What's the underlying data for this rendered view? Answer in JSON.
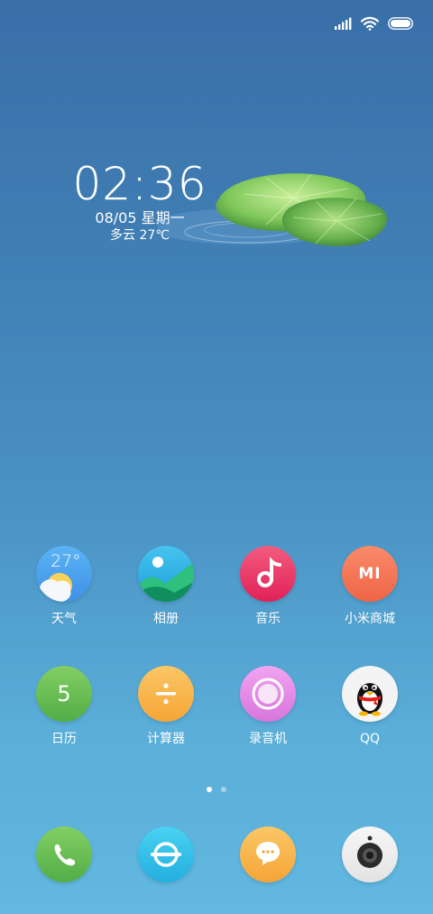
{
  "status_bar": {
    "icons": [
      "signal-icon",
      "wifi-icon",
      "battery-icon"
    ]
  },
  "clock": {
    "time": "02:36",
    "date": "08/05 星期一",
    "weather": "多云 27℃"
  },
  "apps": [
    {
      "label": "天气",
      "icon": "weather-icon",
      "badge_text": "27°",
      "color": "#4aa3f0"
    },
    {
      "label": "相册",
      "icon": "gallery-icon",
      "color": "#2db4e6"
    },
    {
      "label": "音乐",
      "icon": "music-icon",
      "color": "#ef3d6a"
    },
    {
      "label": "小米商城",
      "icon": "mi-store-icon",
      "badge_text": "MI",
      "color": "#f4785a"
    },
    {
      "label": "日历",
      "icon": "calendar-icon",
      "badge_text": "5",
      "color": "#6cc25a"
    },
    {
      "label": "计算器",
      "icon": "calculator-icon",
      "color": "#f8b64c"
    },
    {
      "label": "录音机",
      "icon": "recorder-icon",
      "color": "#e88de8"
    },
    {
      "label": "QQ",
      "icon": "qq-icon",
      "color": "#f2f2f2"
    }
  ],
  "page_indicator": {
    "pages": 2,
    "active": 1
  },
  "dock": [
    {
      "icon": "phone-icon",
      "color": "#6cc25a"
    },
    {
      "icon": "browser-icon",
      "color": "#35c3e8"
    },
    {
      "icon": "messages-icon",
      "color": "#f8b64c"
    },
    {
      "icon": "camera-icon",
      "color": "#efefef"
    }
  ]
}
